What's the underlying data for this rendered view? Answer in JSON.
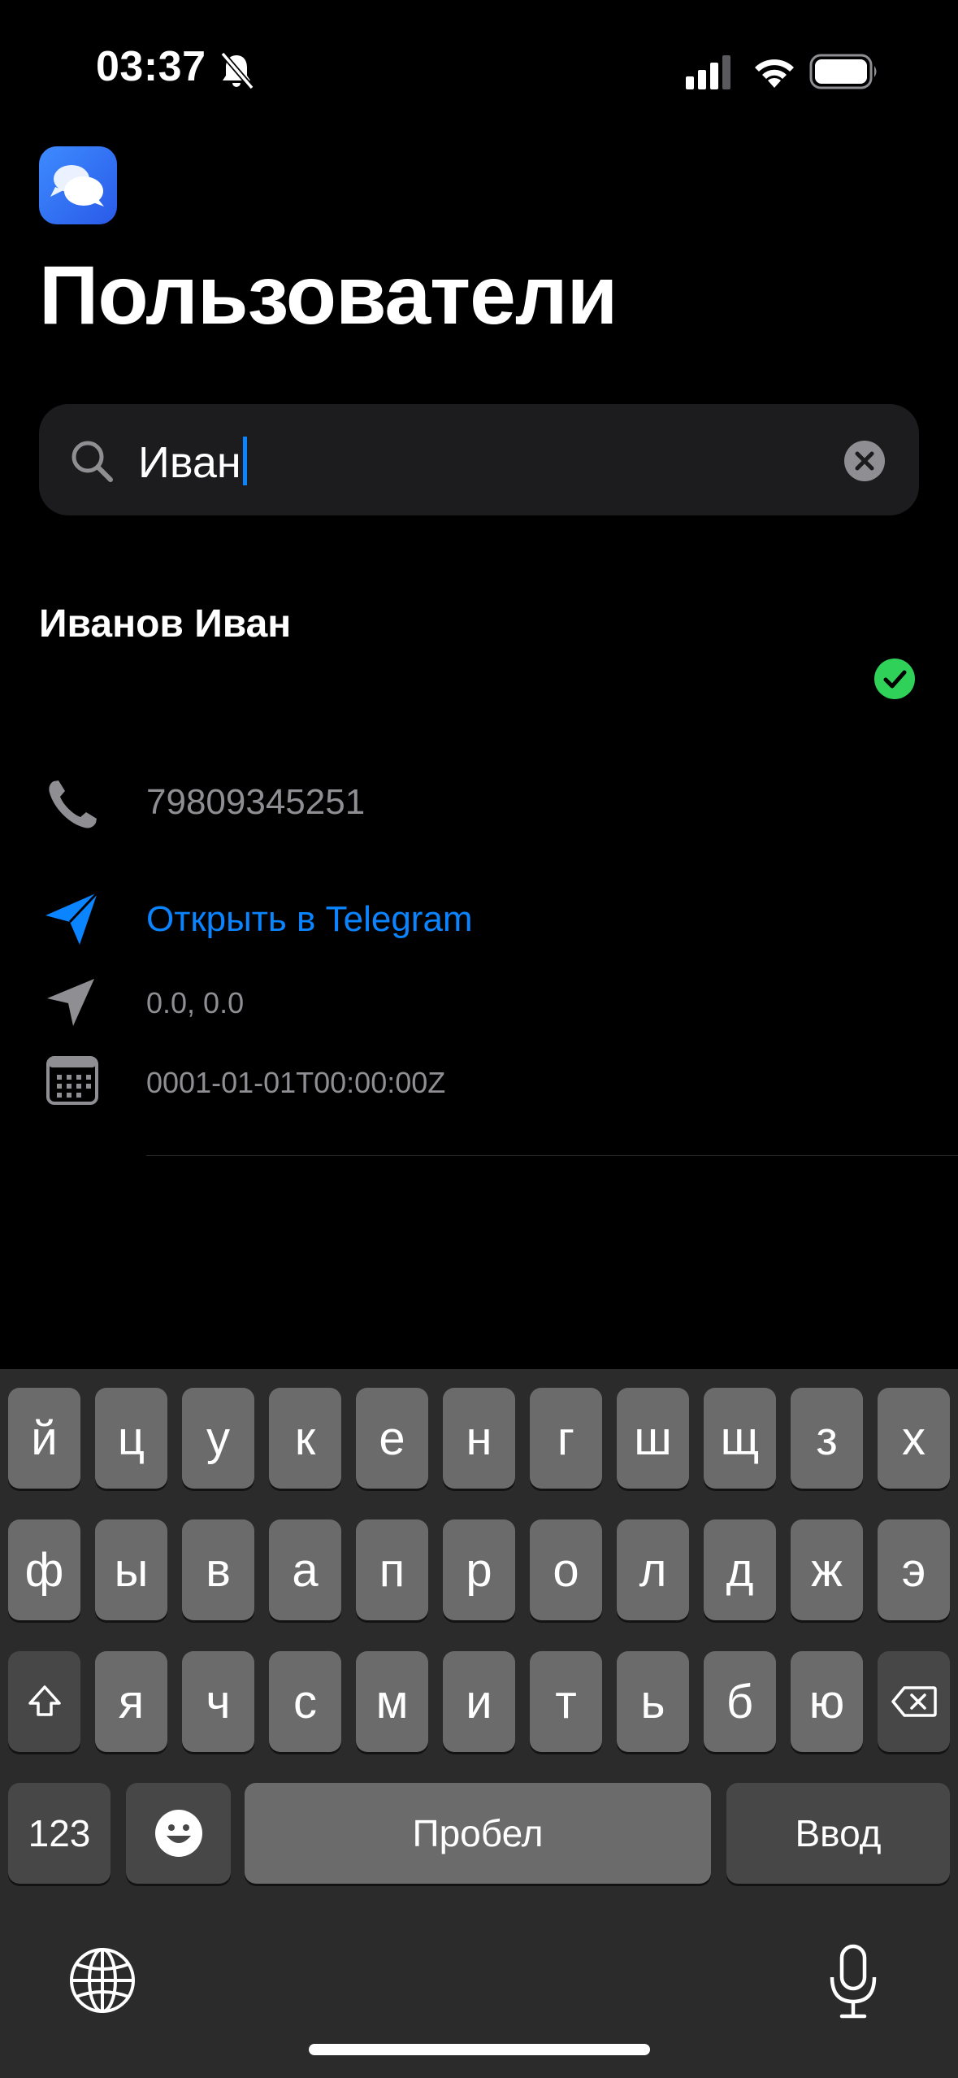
{
  "status_bar": {
    "time": "03:37",
    "icons": [
      "bell-slash-icon",
      "cellular-signal-icon",
      "wifi-icon",
      "battery-icon"
    ]
  },
  "app": {
    "icon": "chat-bubbles-icon",
    "title": "Пользователи"
  },
  "search": {
    "value": "Иван",
    "icon": "magnifier-icon",
    "clear_icon": "clear-x-icon"
  },
  "user": {
    "name": "Иванов Иван",
    "verified": true,
    "phone": "79809345251",
    "telegram_link": "Открыть в Telegram",
    "coordinates": "0.0, 0.0",
    "date": "0001-01-01T00:00:00Z"
  },
  "keyboard": {
    "row1": [
      "й",
      "ц",
      "у",
      "к",
      "е",
      "н",
      "г",
      "ш",
      "щ",
      "з",
      "х"
    ],
    "row2": [
      "ф",
      "ы",
      "в",
      "а",
      "п",
      "р",
      "о",
      "л",
      "д",
      "ж",
      "э"
    ],
    "row3": [
      "я",
      "ч",
      "с",
      "м",
      "и",
      "т",
      "ь",
      "б",
      "ю"
    ],
    "numbers_label": "123",
    "space_label": "Пробел",
    "return_label": "Ввод"
  },
  "colors": {
    "accent": "#0a84ff",
    "success": "#30d158",
    "background": "#000000",
    "search_background": "#1c1c1e",
    "secondary_text": "#8e8e93"
  }
}
